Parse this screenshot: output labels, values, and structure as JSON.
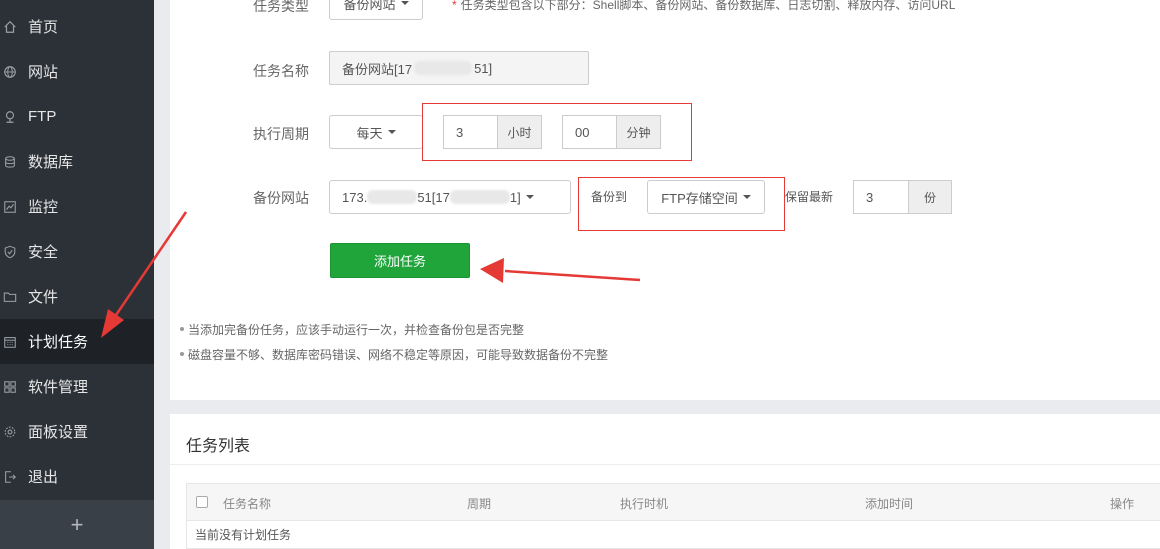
{
  "sidebar": {
    "items": [
      {
        "label": "首页",
        "icon": "home-icon"
      },
      {
        "label": "网站",
        "icon": "globe-icon"
      },
      {
        "label": "FTP",
        "icon": "ftp-icon"
      },
      {
        "label": "数据库",
        "icon": "database-icon"
      },
      {
        "label": "监控",
        "icon": "monitor-icon"
      },
      {
        "label": "安全",
        "icon": "shield-icon"
      },
      {
        "label": "文件",
        "icon": "folder-icon"
      },
      {
        "label": "计划任务",
        "icon": "calendar-icon"
      },
      {
        "label": "软件管理",
        "icon": "grid-icon"
      },
      {
        "label": "面板设置",
        "icon": "gear-icon"
      },
      {
        "label": "退出",
        "icon": "logout-icon"
      }
    ],
    "active_index": 7,
    "add_label": "+"
  },
  "form": {
    "task_type_label": "任务类型",
    "task_type_value": "备份网站",
    "task_type_hint": "任务类型包含以下部分：Shell脚本、备份网站、备份数据库、日志切割、释放内存、访问URL",
    "task_name_label": "任务名称",
    "task_name_prefix": "备份网站[17",
    "task_name_suffix": "51]",
    "period_label": "执行周期",
    "period_value": "每天",
    "hour_value": "3",
    "hour_unit": "小时",
    "minute_value": "00",
    "minute_unit": "分钟",
    "site_label": "备份网站",
    "site_part1": "173.",
    "site_part2": "51[17",
    "site_part3": "1]",
    "backup_to_label": "备份到",
    "backup_to_value": "FTP存储空间",
    "keep_label": "保留最新",
    "keep_value": "3",
    "keep_unit": "份",
    "submit_label": "添加任务"
  },
  "notes": [
    "当添加完备份任务，应该手动运行一次，并检查备份包是否完整",
    "磁盘容量不够、数据库密码错误、网络不稳定等原因，可能导致数据备份不完整"
  ],
  "task_list": {
    "title": "任务列表",
    "columns": [
      "任务名称",
      "周期",
      "执行时机",
      "添加时间",
      "操作"
    ],
    "empty_text": "当前没有计划任务"
  },
  "colors": {
    "sidebar_bg": "#2c3138",
    "primary_green": "#20a53a",
    "annotation_red": "#e53935"
  }
}
